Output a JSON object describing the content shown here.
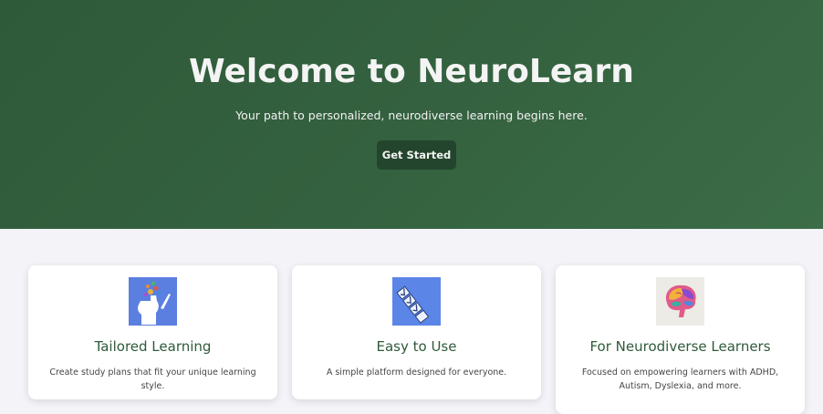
{
  "hero": {
    "title": "Welcome to NeuroLearn",
    "subtitle": "Your path to personalized, neurodiverse learning begins here.",
    "cta_label": "Get Started"
  },
  "features": [
    {
      "icon": "head-ideas-icon",
      "title": "Tailored Learning",
      "description": "Create study plans that fit your unique learning style."
    },
    {
      "icon": "checklist-icon",
      "title": "Easy to Use",
      "description": "A simple platform designed for everyone."
    },
    {
      "icon": "colorful-brain-icon",
      "title": "For Neurodiverse Learners",
      "description": "Focused on empowering learners with ADHD, Autism, Dyslexia, and more."
    }
  ],
  "colors": {
    "hero_bg": "#34613f",
    "cta_bg": "#24452d",
    "card_title": "#2f5a3a",
    "page_bg": "#f3f3f8"
  }
}
